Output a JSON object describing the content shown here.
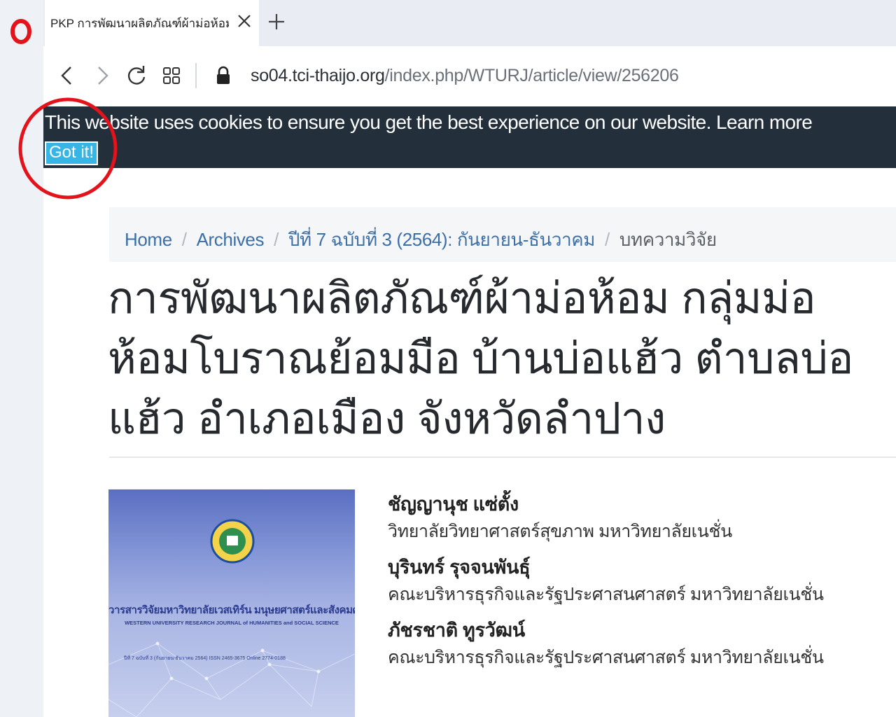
{
  "browser": {
    "tab": {
      "title": "PKP การพัฒนาผลิตภัณฑ์ผ้าม่อห้อม กลุ่มม่อห้อม",
      "close_icon": "close-icon"
    },
    "new_tab_icon": "plus-icon",
    "url": {
      "host": "so04.tci-thaijo.org",
      "path": "/index.php/WTURJ/article/view/256206"
    }
  },
  "cookie_banner": {
    "message": "This website uses cookies to ensure you get the best experience on our website.",
    "learn_more": "Learn more",
    "button": "Got it!"
  },
  "annotation": {
    "color": "#e3121b"
  },
  "breadcrumb": {
    "items": [
      "Home",
      "Archives",
      "ปีที่ 7 ฉบับที่ 3 (2564): กันยายน-ธันวาคม"
    ],
    "current": "บทความวิจัย",
    "separator": "/"
  },
  "article": {
    "title": "การพัฒนาผลิตภัณฑ์ผ้าม่อห้อม กลุ่มม่อห้อมโบราณย้อมมือ บ้านบ่อแฮ้ว ตำบลบ่อแฮ้ว อำเภอเมือง จังหวัดลำปาง",
    "cover": {
      "title": "วารสารวิจัยมหาวิทยาลัยเวสเทิร์น มนุษยศาสตร์และสังคมศาสตร์",
      "subtitle": "WESTERN UNIVERSITY RESEARCH JOURNAL of HUMANITIES and SOCIAL SCIENCE",
      "issue": "ปีที่ 7 ฉบับที่ 3 (กันยายน-ธันวาคม 2564)   ISSN 2465-3675 Online 2774-0188"
    },
    "authors": [
      {
        "name": "ชัญญานุช แซ่ตั้ง",
        "affiliation": "วิทยาลัยวิทยาศาสตร์สุขภาพ มหาวิทยาลัยเนชั่น"
      },
      {
        "name": "บุรินทร์ รุจจนพันธุ์",
        "affiliation": "คณะบริหารธุรกิจและรัฐประศาสนศาสตร์ มหาวิทยาลัยเนชั่น"
      },
      {
        "name": "ภัชรชาติ ทูรวัฒน์",
        "affiliation": "คณะบริหารธุรกิจและรัฐประศาสนศาสตร์ มหาวิทยาลัยเนชั่น"
      }
    ]
  }
}
